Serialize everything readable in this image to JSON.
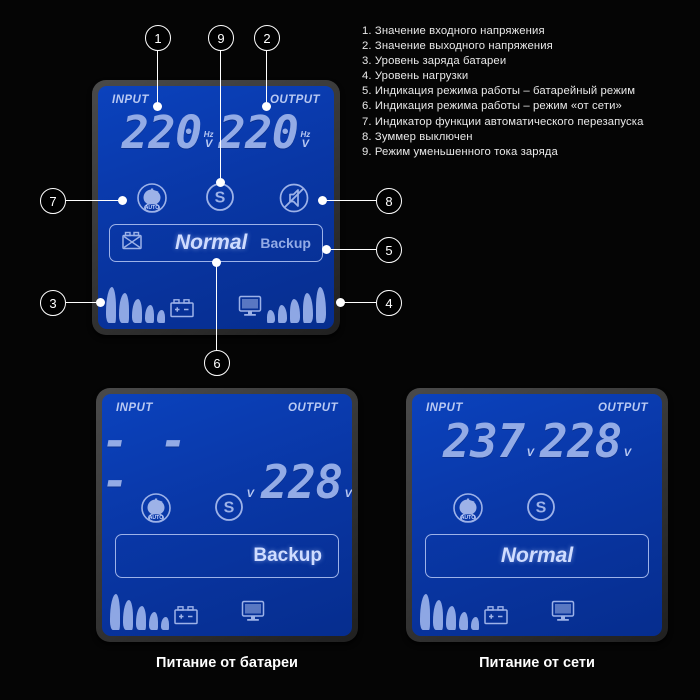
{
  "legend": {
    "items": [
      "1. Значение входного напряжения",
      "2. Значение выходного напряжения",
      "3. Уровень заряда батареи",
      "4. Уровень нагрузки",
      "5. Индикация режима работы – батарейный режим",
      "6. Индикация режима работы – режим «от сети»",
      "7. Индикатор функции автоматического перезапуска",
      "8. Зуммер выключен",
      "9. Режим уменьшенного тока заряда"
    ]
  },
  "main_panel": {
    "input_label": "INPUT",
    "output_label": "OUTPUT",
    "input_value": "220",
    "output_value": "220",
    "unit_top": "Hz",
    "unit_bottom": "V",
    "icons": {
      "auto_restart": "auto-restart-icon",
      "auto_restart_text": "AUTO",
      "smart_charge": "S",
      "buzzer_off": "buzzer-off-icon"
    },
    "status": {
      "battery_fault_icon": "battery-cross-icon",
      "mode_active": "Normal",
      "mode_inactive": "Backup"
    },
    "gauges": {
      "battery_icon": "battery-icon",
      "load_icon": "monitor-icon",
      "battery_bars": 5,
      "load_bars": 5
    }
  },
  "battery_panel": {
    "input_label": "INPUT",
    "output_label": "OUTPUT",
    "input_value": "- - -",
    "output_value": "228",
    "unit": "V",
    "icons": {
      "auto_restart_text": "AUTO",
      "smart_charge": "S"
    },
    "status_mode": "Backup",
    "gauges": {
      "battery_icon": "battery-icon",
      "load_icon": "monitor-icon",
      "battery_bars": 5,
      "load_bars": 0
    },
    "caption": "Питание от батареи"
  },
  "mains_panel": {
    "input_label": "INPUT",
    "output_label": "OUTPUT",
    "input_value": "237",
    "output_value": "228",
    "unit": "V",
    "icons": {
      "auto_restart_text": "AUTO",
      "smart_charge": "S"
    },
    "status_mode": "Normal",
    "gauges": {
      "battery_icon": "battery-icon",
      "load_icon": "monitor-icon",
      "battery_bars": 5,
      "load_bars": 0
    },
    "caption": "Питание от сети"
  },
  "callouts": {
    "c1": "1",
    "c2": "2",
    "c3": "3",
    "c4": "4",
    "c5": "5",
    "c6": "6",
    "c7": "7",
    "c8": "8",
    "c9": "9"
  },
  "colors": {
    "lcd_background": "#0937a6",
    "lcd_segment": "#93abe6",
    "lcd_highlight": "#cfdcff",
    "bezel": "#3a3a3a",
    "page_background": "#000000",
    "callout_stroke": "#ffffff"
  }
}
